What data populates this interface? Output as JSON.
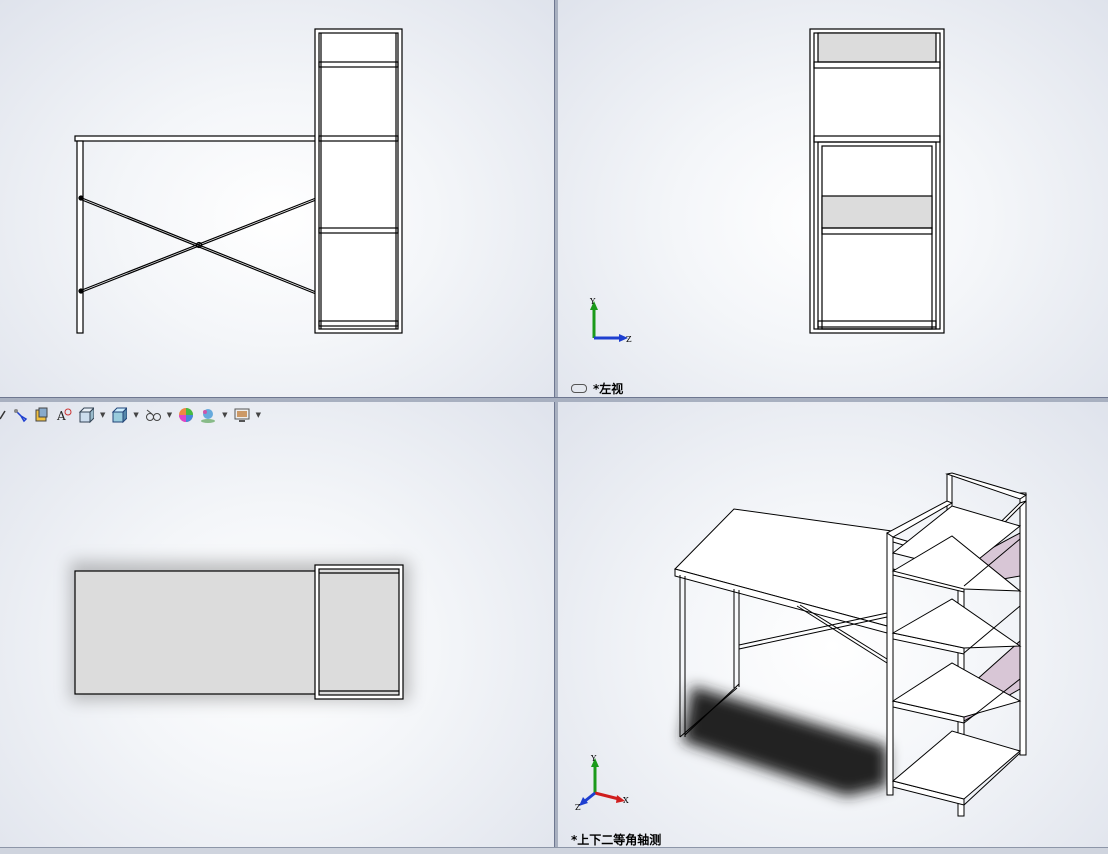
{
  "viewports": {
    "top_left": {
      "label": ""
    },
    "top_right": {
      "label": "*左视"
    },
    "bottom_left": {
      "label": ""
    },
    "bottom_right": {
      "label": "*上下二等角轴测"
    }
  },
  "triad": {
    "y_axis": "Y",
    "z_axis": "Z",
    "x_axis": "X",
    "y_color": "#1a9a1a",
    "z_color": "#1e3fd0",
    "x_color": "#d01e1e"
  },
  "toolbar": {
    "icons": [
      "zoom-icon",
      "tool-icon",
      "section-view-icon",
      "dynamic-annotation-icon",
      "view-orientation-icon",
      "display-style-icon",
      "hide-show-icon",
      "appearance-icon",
      "scene-icon",
      "view-settings-icon"
    ]
  },
  "colors": {
    "panel_fill": "#dcdcdc",
    "accent_panel": "#d8c6d6",
    "shadow": "#222222"
  }
}
